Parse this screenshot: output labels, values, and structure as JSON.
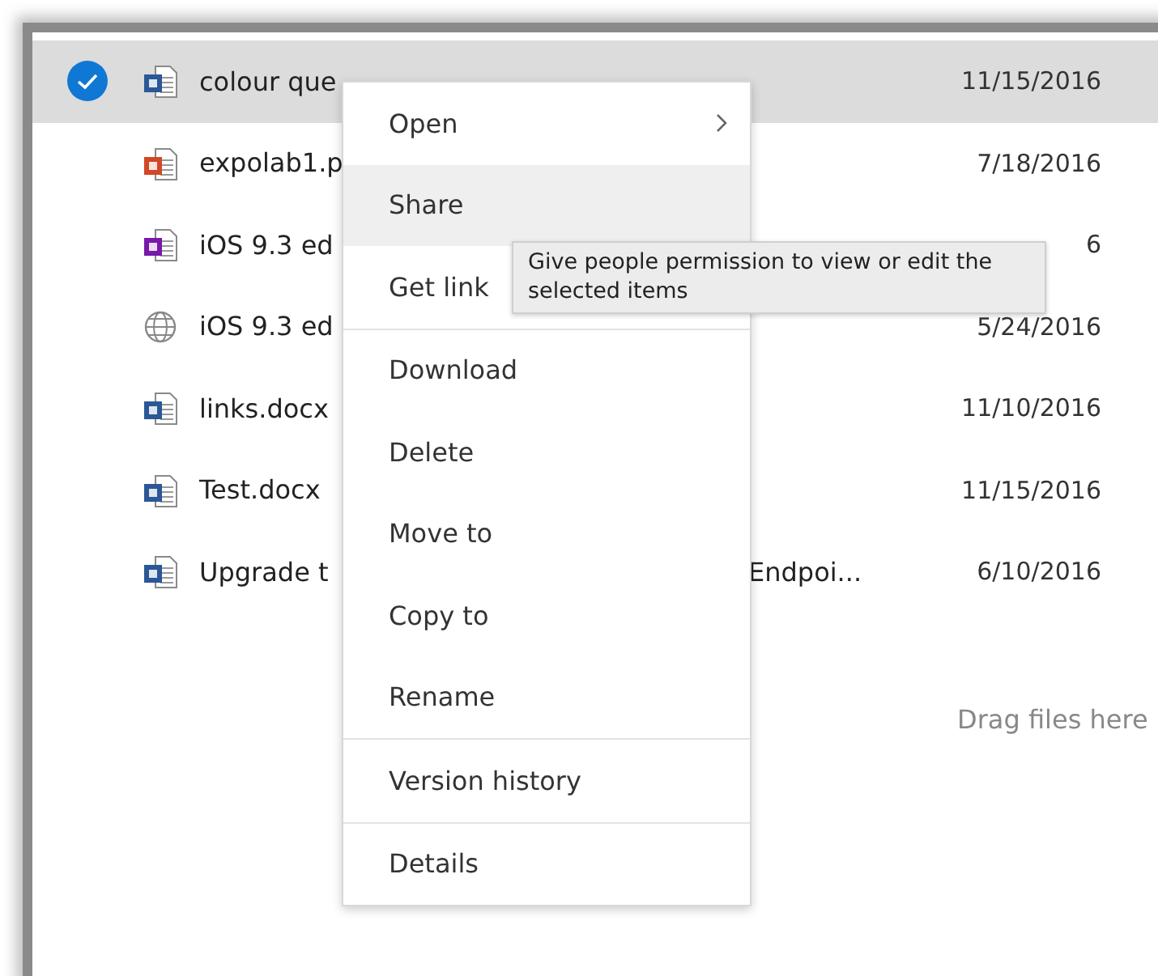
{
  "files": [
    {
      "name": "colour que",
      "kind": "word",
      "date": "11/15/2016",
      "selected": true
    },
    {
      "name": "expolab1.p",
      "kind": "powerpoint",
      "date": "7/18/2016",
      "selected": false
    },
    {
      "name": "iOS 9.3 ed",
      "kind": "onenote",
      "date": "6",
      "selected": false
    },
    {
      "name": "iOS 9.3 ed",
      "kind": "web",
      "date": "5/24/2016",
      "selected": false
    },
    {
      "name": "links.docx",
      "kind": "word",
      "date": "11/10/2016",
      "selected": false
    },
    {
      "name": "Test.docx",
      "kind": "word",
      "date": "11/15/2016",
      "selected": false
    },
    {
      "name": "Upgrade t",
      "kind": "word",
      "extra": "Endpoi...",
      "date": "6/10/2016",
      "selected": false
    }
  ],
  "drop_hint": "Drag files here",
  "context_menu": {
    "groups": [
      [
        {
          "label": "Open",
          "submenu": true,
          "highlighted": false
        },
        {
          "label": "Share",
          "highlighted": true
        },
        {
          "label": "Get link",
          "highlighted": false
        }
      ],
      [
        {
          "label": "Download",
          "highlighted": false
        },
        {
          "label": "Delete",
          "highlighted": false
        },
        {
          "label": "Move to",
          "highlighted": false
        },
        {
          "label": "Copy to",
          "highlighted": false
        },
        {
          "label": "Rename",
          "highlighted": false
        }
      ],
      [
        {
          "label": "Version history",
          "highlighted": false
        }
      ],
      [
        {
          "label": "Details",
          "highlighted": false
        }
      ]
    ]
  },
  "tooltip": "Give people permission to view or edit the selected items"
}
